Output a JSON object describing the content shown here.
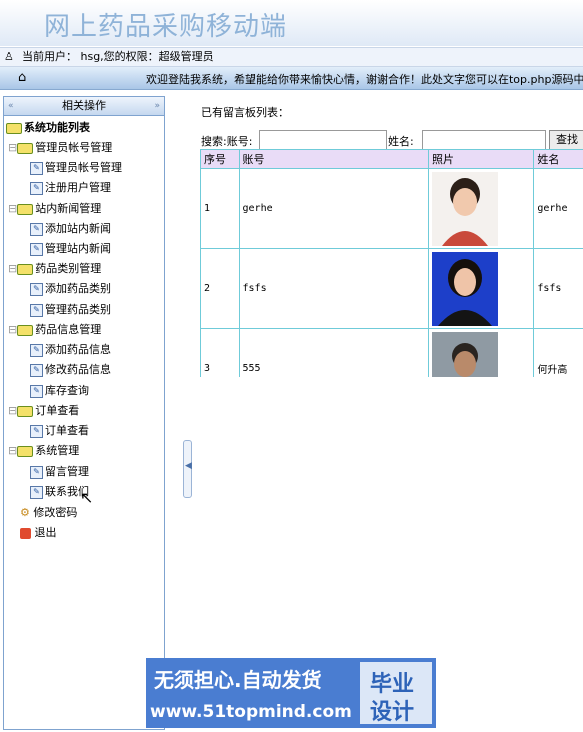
{
  "header": {
    "title": "网上药品采购移动端"
  },
  "userbar": {
    "text": "当前用户： hsg,您的权限：超级管理员"
  },
  "navbar": {
    "marquee": "欢迎登陆我系统，希望能给你带来愉快心情，谢谢合作！此处文字您可以在top.php源码中修"
  },
  "sidebar": {
    "heading": "相关操作",
    "root": "系统功能列表",
    "groups": [
      {
        "label": "管理员帐号管理",
        "items": [
          "管理员帐号管理",
          "注册用户管理"
        ]
      },
      {
        "label": "站内新闻管理",
        "items": [
          "添加站内新闻",
          "管理站内新闻"
        ]
      },
      {
        "label": "药品类别管理",
        "items": [
          "添加药品类别",
          "管理药品类别"
        ]
      },
      {
        "label": "药品信息管理",
        "items": [
          "添加药品信息",
          "修改药品信息",
          "库存查询"
        ]
      },
      {
        "label": "订单查看",
        "items": [
          "订单查看"
        ]
      },
      {
        "label": "系统管理",
        "items": [
          "留言管理",
          "联系我们"
        ]
      }
    ],
    "extra": [
      "修改密码",
      "退出"
    ]
  },
  "main": {
    "title": "已有留言板列表：",
    "search": {
      "label1": "搜索:账号:",
      "label2": "姓名:",
      "button": "查找",
      "value1": "",
      "value2": ""
    },
    "table": {
      "headers": [
        "序号",
        "账号",
        "照片",
        "姓名"
      ],
      "rows": [
        {
          "no": "1",
          "account": "gerhe",
          "name": "gerhe"
        },
        {
          "no": "2",
          "account": "fsfs",
          "name": "fsfs"
        },
        {
          "no": "3",
          "account": "555",
          "name": "何升高"
        }
      ]
    }
  },
  "banner": {
    "line1": "无须担心.自动发货",
    "line2": "www.51topmind.com",
    "right_top": "毕业",
    "right_bottom": "设计"
  }
}
